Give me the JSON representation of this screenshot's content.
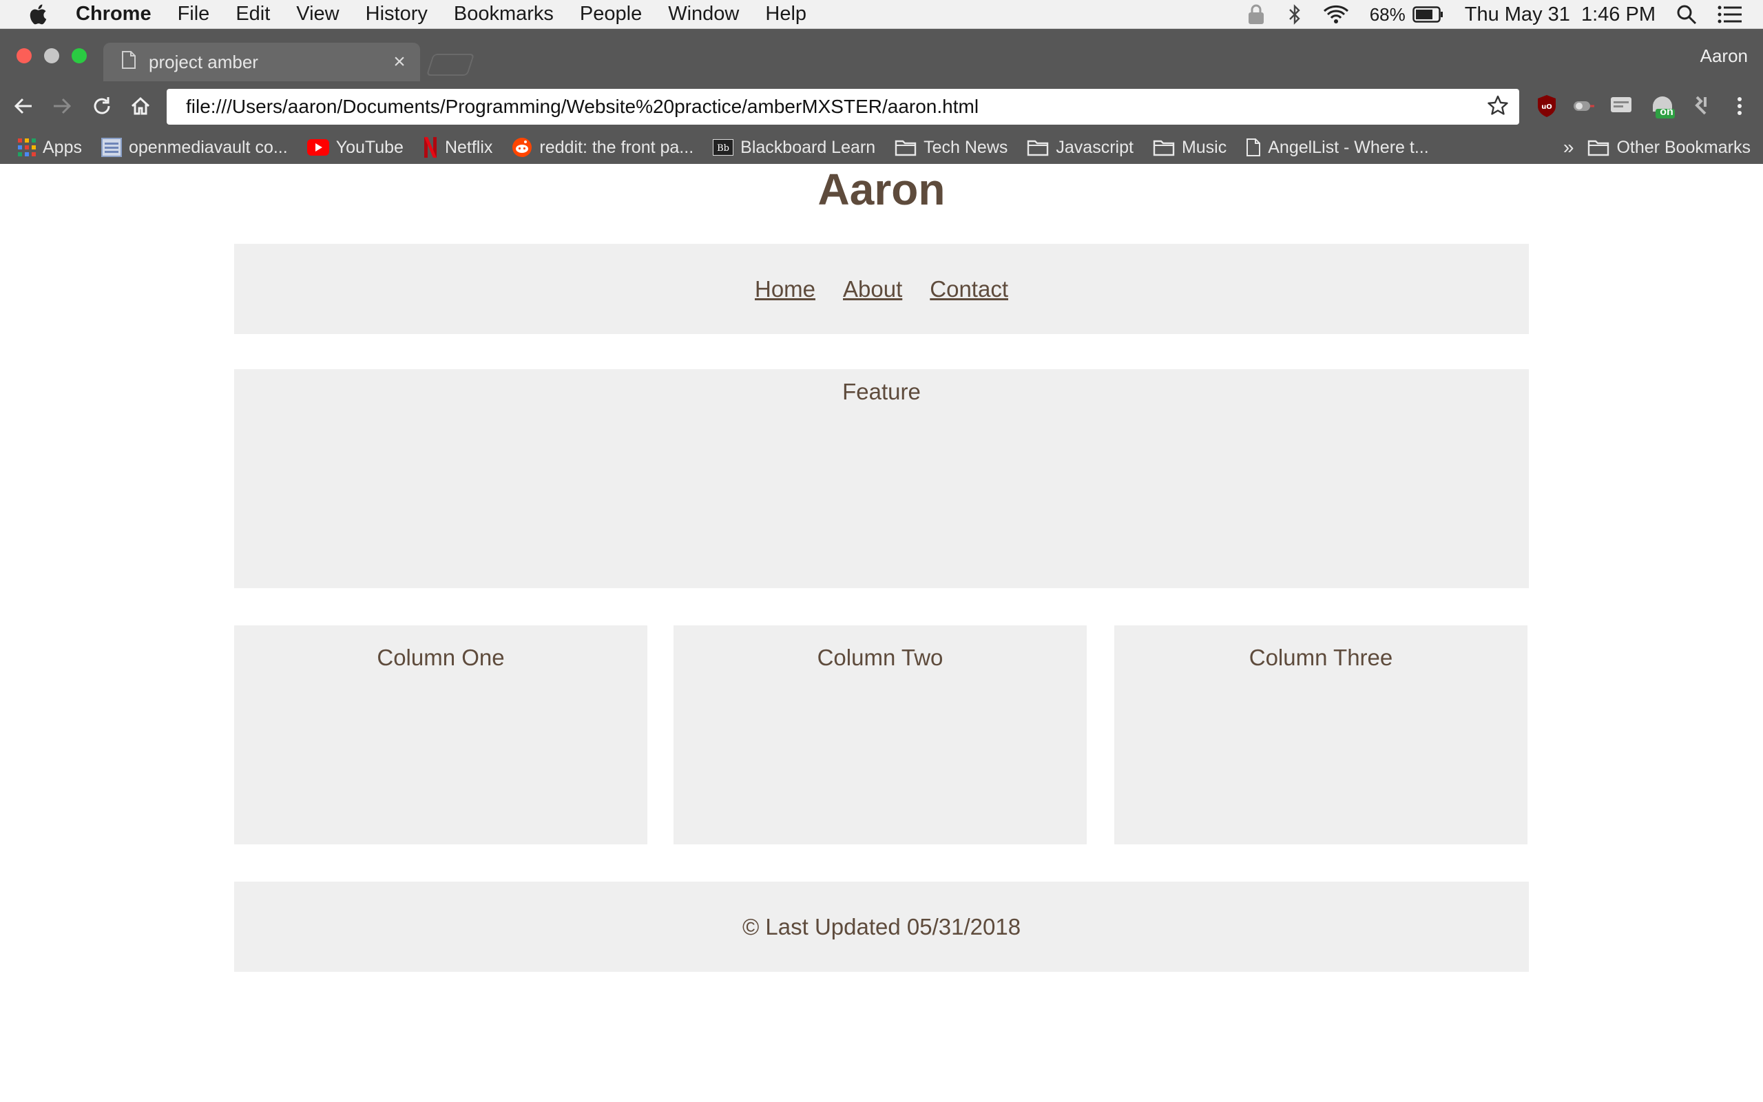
{
  "menubar": {
    "app_name": "Chrome",
    "items": [
      "File",
      "Edit",
      "View",
      "History",
      "Bookmarks",
      "People",
      "Window",
      "Help"
    ],
    "battery": "68%",
    "datetime": "Thu May 31  1:46 PM"
  },
  "browser": {
    "tab_title": "project amber",
    "tab_close": "×",
    "profile_name": "Aaron",
    "url": "file:///Users/aaron/Documents/Programming/Website%20practice/amberMXSTER/aaron.html",
    "extension_badge": "on"
  },
  "bookmarks": {
    "items": [
      {
        "label": "Apps",
        "icon": "apps-grid-icon"
      },
      {
        "label": "openmediavault co...",
        "icon": "page-icon"
      },
      {
        "label": "YouTube",
        "icon": "youtube-icon"
      },
      {
        "label": "Netflix",
        "icon": "netflix-icon"
      },
      {
        "label": "reddit: the front pa...",
        "icon": "reddit-icon"
      },
      {
        "label": "Blackboard Learn",
        "icon": "blackboard-icon"
      },
      {
        "label": "Tech News",
        "icon": "folder-icon"
      },
      {
        "label": "Javascript",
        "icon": "folder-icon"
      },
      {
        "label": "Music",
        "icon": "folder-icon"
      },
      {
        "label": "AngelList - Where t...",
        "icon": "document-icon"
      }
    ],
    "overflow": "»",
    "other": "Other Bookmarks"
  },
  "page": {
    "title": "Aaron",
    "nav": [
      "Home",
      "About",
      "Contact"
    ],
    "feature": "Feature",
    "columns": [
      "Column One",
      "Column Two",
      "Column Three"
    ],
    "footer": "© Last Updated 05/31/2018"
  },
  "colors": {
    "text": "#5e4b3c",
    "box_bg": "#efefef",
    "chrome_dark": "#575757"
  }
}
